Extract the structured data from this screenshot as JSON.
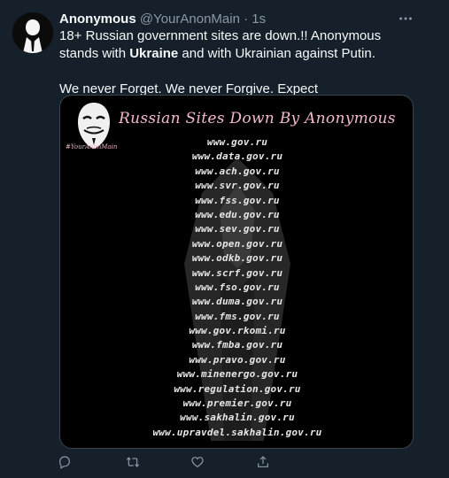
{
  "tweet": {
    "author_name": "Anonymous",
    "handle": "@YourAnonMain",
    "separator": "·",
    "time": "1s",
    "text_part1": "18+ Russian government sites are down.!! Anonymous stands with ",
    "text_bold": "Ukraine",
    "text_part2": " and with Ukrainian against Putin.",
    "text_line2": "We never Forget. We never Forgive. Expect Us..Anonymous."
  },
  "media": {
    "title": "Russian Sites Down By Anonymous",
    "watermark": "#YourAnonMain",
    "sites": [
      "www.gov.ru",
      "www.data.gov.ru",
      "www.ach.gov.ru",
      "www.svr.gov.ru",
      "www.fss.gov.ru",
      "www.edu.gov.ru",
      "www.sev.gov.ru",
      "www.open.gov.ru",
      "www.odkb.gov.ru",
      "www.scrf.gov.ru",
      "www.fso.gov.ru",
      "www.duma.gov.ru",
      "www.fms.gov.ru",
      "www.gov.rkomi.ru",
      "www.fmba.gov.ru",
      "www.pravo.gov.ru",
      "www.minenergo.gov.ru",
      "www.regulation.gov.ru",
      "www.premier.gov.ru",
      "www.sakhalin.gov.ru",
      "www.upravdel.sakhalin.gov.ru"
    ]
  },
  "icons": {
    "more": "more-icon",
    "reply": "reply-icon",
    "retweet": "retweet-icon",
    "like": "like-icon",
    "share": "share-icon"
  },
  "colors": {
    "background": "#15202b",
    "secondary_text": "#8b98a5",
    "title_pink": "#f2b8cf"
  }
}
